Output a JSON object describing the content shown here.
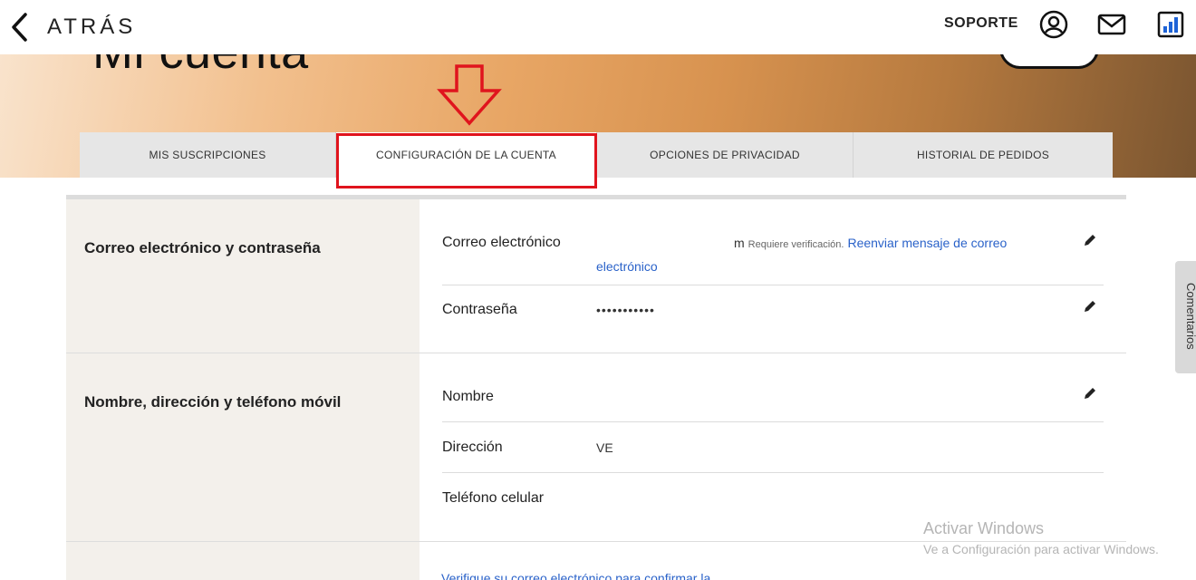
{
  "header": {
    "back_label": "ATRÁS",
    "support_label": "SOPORTE",
    "icons": [
      "user-circle-icon",
      "mail-icon",
      "chart-icon"
    ]
  },
  "hero": {
    "title": "Mi cuenta"
  },
  "tabs": [
    {
      "label": "MIS SUSCRIPCIONES",
      "active": false
    },
    {
      "label": "CONFIGURACIÓN DE LA CUENTA",
      "active": true
    },
    {
      "label": "OPCIONES DE PRIVACIDAD",
      "active": false
    },
    {
      "label": "HISTORIAL DE PEDIDOS",
      "active": false
    }
  ],
  "sections": {
    "credentials": {
      "title": "Correo electrónico y contraseña",
      "email_label": "Correo electrónico",
      "email_value_tail": "m",
      "email_status": "Requiere verificación.",
      "resend_link_part1": "Reenviar mensaje de correo",
      "resend_link_part2": "electrónico",
      "password_label": "Contraseña",
      "password_value": "•••••••••••"
    },
    "personal": {
      "title": "Nombre, dirección y teléfono móvil",
      "name_label": "Nombre",
      "name_value": "",
      "address_label": "Dirección",
      "address_value": "VE",
      "phone_label": "Teléfono celular",
      "phone_value": ""
    },
    "next": {
      "link_partial": "Verifique su correo electrónico para confirmar la"
    }
  },
  "feedback_tab": {
    "label": "Comentarios"
  },
  "watermark": {
    "line1": "Activar Windows",
    "line2": "Ve a Configuración para activar Windows."
  },
  "colors": {
    "link": "#2a62c9",
    "highlight": "#e0141d",
    "section_bg": "#f3f0eb",
    "tab_bg": "#e6e6e6"
  }
}
